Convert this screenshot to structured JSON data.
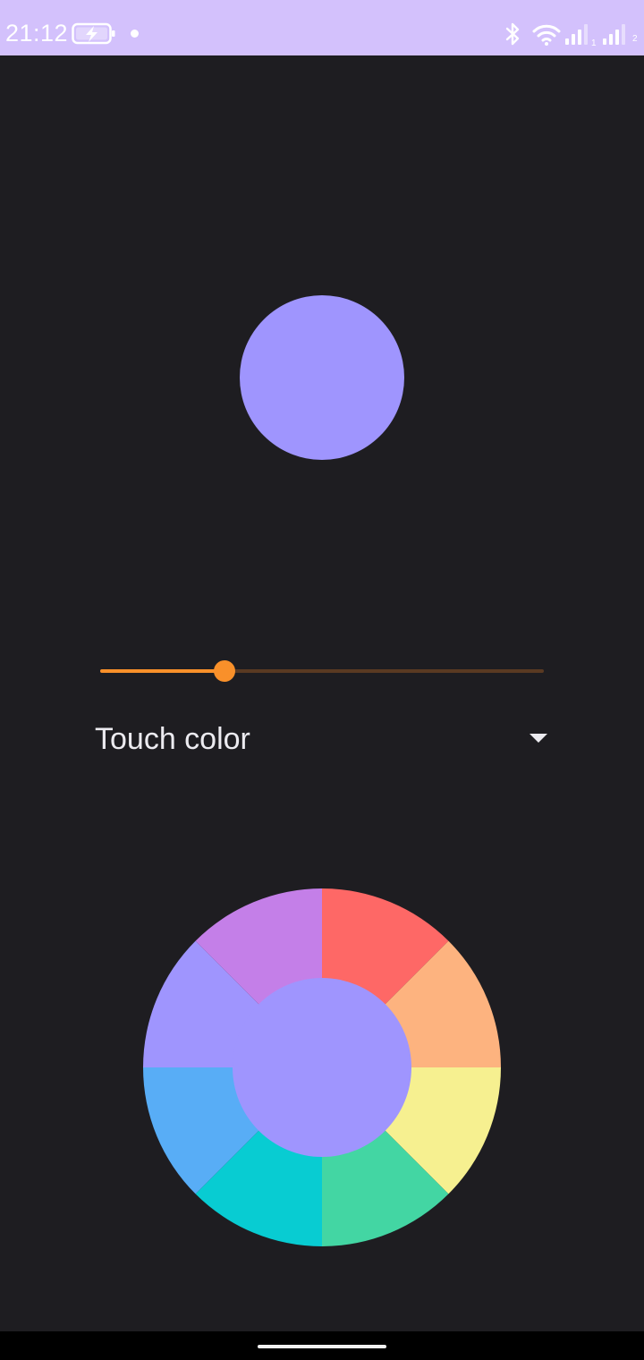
{
  "status_bar": {
    "time": "21:12",
    "icons": [
      "battery-charging-icon",
      "notification-dot-icon",
      "bluetooth-icon",
      "wifi-icon",
      "signal-sim1-icon",
      "signal-sim2-icon"
    ],
    "sim1_label": "1",
    "sim2_label": "2",
    "background": "#d3c1fc"
  },
  "preview": {
    "color": "#9f95fe"
  },
  "slider": {
    "value_fraction": 0.28,
    "active_color": "#f9902a",
    "inactive_color": "#5a3a22"
  },
  "dropdown": {
    "selected": "Touch color"
  },
  "color_wheel": {
    "center_color": "#9f95fe",
    "segments": [
      {
        "name": "red",
        "color": "#fe6866"
      },
      {
        "name": "orange",
        "color": "#fdb37f"
      },
      {
        "name": "yellow",
        "color": "#f6f090"
      },
      {
        "name": "green",
        "color": "#43d6a3"
      },
      {
        "name": "cyan",
        "color": "#08ccd2"
      },
      {
        "name": "blue",
        "color": "#58adf6"
      },
      {
        "name": "periwinkle",
        "color": "#9f95fe"
      },
      {
        "name": "purple",
        "color": "#c47fe8"
      }
    ]
  },
  "nav_bar": {
    "indicator": "home-indicator"
  }
}
